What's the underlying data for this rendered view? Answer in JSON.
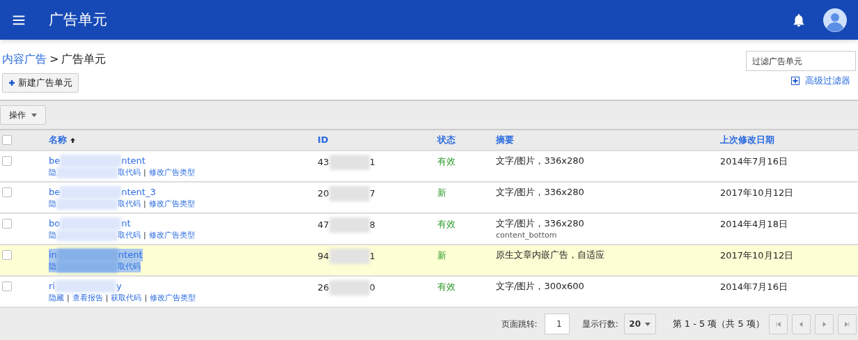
{
  "app_bar": {
    "title": "广告单元"
  },
  "breadcrumb": {
    "parent": "内容广告",
    "separator": ">",
    "current": "广告单元"
  },
  "new_button": "新建广告单元",
  "filter": {
    "placeholder": "过滤广告单元"
  },
  "advanced_filter": "高级过滤器",
  "actions_button": "操作",
  "table": {
    "header_checked": false,
    "columns": [
      {
        "label": "名称",
        "sorted": true
      },
      {
        "label": "ID",
        "sorted": false
      },
      {
        "label": "状态",
        "sorted": false
      },
      {
        "label": "摘要",
        "sorted": false
      },
      {
        "label": "上次修改日期",
        "sorted": false
      }
    ],
    "rows": [
      {
        "checked": false,
        "highlighted": false,
        "name_selected": false,
        "name": [
          {
            "kind": "text",
            "text": "be"
          },
          {
            "kind": "redacted"
          },
          {
            "kind": "text",
            "text": "ntent"
          }
        ],
        "links": [
          {
            "kind": "text",
            "text": "隐"
          },
          {
            "kind": "redacted"
          },
          {
            "kind": "text",
            "text": "取代码"
          },
          {
            "kind": "sep",
            "text": "|"
          },
          {
            "kind": "text",
            "text": "修改广告类型"
          }
        ],
        "id": [
          {
            "kind": "text",
            "text": "43"
          },
          {
            "kind": "redacted"
          },
          {
            "kind": "text",
            "text": "1"
          }
        ],
        "status": "有效",
        "summary": "文字/图片，336x280",
        "date": "2014年7月16日"
      },
      {
        "checked": false,
        "highlighted": false,
        "name_selected": false,
        "name": [
          {
            "kind": "text",
            "text": "be"
          },
          {
            "kind": "redacted"
          },
          {
            "kind": "text",
            "text": "ntent_3"
          }
        ],
        "links": [
          {
            "kind": "text",
            "text": "隐"
          },
          {
            "kind": "redacted"
          },
          {
            "kind": "text",
            "text": "取代码"
          },
          {
            "kind": "sep",
            "text": "|"
          },
          {
            "kind": "text",
            "text": "修改广告类型"
          }
        ],
        "id": [
          {
            "kind": "text",
            "text": "20"
          },
          {
            "kind": "redacted"
          },
          {
            "kind": "text",
            "text": "7"
          }
        ],
        "status": "新",
        "summary": "文字/图片，336x280",
        "date": "2017年10月12日"
      },
      {
        "checked": false,
        "highlighted": false,
        "name_selected": false,
        "name": [
          {
            "kind": "text",
            "text": "bo"
          },
          {
            "kind": "redacted"
          },
          {
            "kind": "text",
            "text": "nt"
          }
        ],
        "links": [
          {
            "kind": "text",
            "text": "隐"
          },
          {
            "kind": "redacted"
          },
          {
            "kind": "text",
            "text": "取代码"
          },
          {
            "kind": "sep",
            "text": "|"
          },
          {
            "kind": "text",
            "text": "修改广告类型"
          }
        ],
        "id": [
          {
            "kind": "text",
            "text": "47"
          },
          {
            "kind": "redacted"
          },
          {
            "kind": "text",
            "text": "8"
          }
        ],
        "status": "有效",
        "summary": "文字/图片，336x280",
        "summary_note": "content_bottom",
        "date": "2014年4月18日"
      },
      {
        "checked": false,
        "highlighted": true,
        "name_selected": true,
        "name": [
          {
            "kind": "text",
            "text": "in"
          },
          {
            "kind": "redacted"
          },
          {
            "kind": "text",
            "text": "ntent"
          }
        ],
        "links": [
          {
            "kind": "text",
            "text": "隐"
          },
          {
            "kind": "redacted"
          },
          {
            "kind": "text",
            "text": "取代码"
          }
        ],
        "id": [
          {
            "kind": "text",
            "text": "94"
          },
          {
            "kind": "redacted"
          },
          {
            "kind": "text",
            "text": "1"
          }
        ],
        "status": "新",
        "summary": "原生文章内嵌广告，自适应",
        "date": "2017年10月12日"
      },
      {
        "checked": false,
        "highlighted": false,
        "name_selected": false,
        "name": [
          {
            "kind": "text",
            "text": "ri"
          },
          {
            "kind": "redacted"
          },
          {
            "kind": "text",
            "text": "y"
          }
        ],
        "links": [
          {
            "kind": "text",
            "text": "隐藏"
          },
          {
            "kind": "sep",
            "text": "|"
          },
          {
            "kind": "text",
            "text": "查看报告"
          },
          {
            "kind": "sep",
            "text": "|"
          },
          {
            "kind": "text",
            "text": "获取代码"
          },
          {
            "kind": "sep",
            "text": "|"
          },
          {
            "kind": "text",
            "text": "修改广告类型"
          }
        ],
        "id": [
          {
            "kind": "text",
            "text": "26"
          },
          {
            "kind": "redacted"
          },
          {
            "kind": "text",
            "text": "0"
          }
        ],
        "status": "有效",
        "summary": "文字/图片，300x600",
        "date": "2014年7月16日"
      }
    ]
  },
  "pagination": {
    "jump_label": "页面跳转:",
    "page": "1",
    "rows_label": "显示行数:",
    "rows_per_page": "20",
    "range": "第 1 - 5 项（共 5 项）"
  }
}
